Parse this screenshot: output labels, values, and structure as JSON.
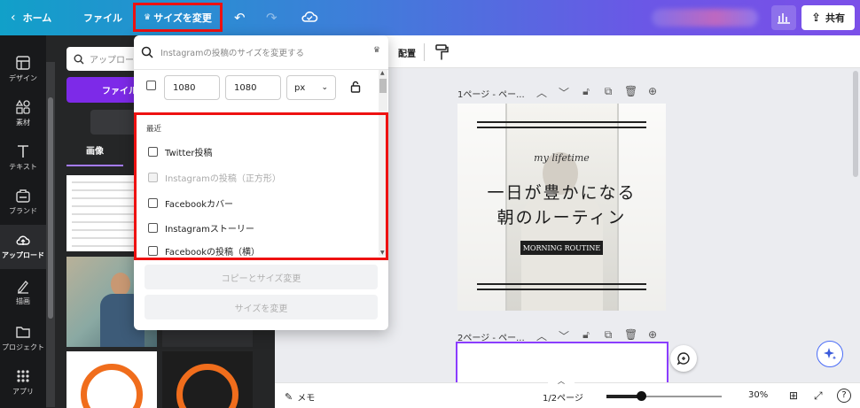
{
  "topbar": {
    "home": "ホーム",
    "file": "ファイル",
    "resize": "サイズを変更",
    "share": "共有"
  },
  "rail": [
    {
      "label": "デザイン",
      "icon": "design-icon"
    },
    {
      "label": "素材",
      "icon": "elements-icon"
    },
    {
      "label": "テキスト",
      "icon": "text-icon"
    },
    {
      "label": "ブランド",
      "icon": "brand-icon"
    },
    {
      "label": "アップロード",
      "icon": "upload-icon",
      "active": true
    },
    {
      "label": "描画",
      "icon": "draw-icon"
    },
    {
      "label": "プロジェクト",
      "icon": "folder-icon"
    },
    {
      "label": "アプリ",
      "icon": "apps-icon"
    }
  ],
  "panel": {
    "search_placeholder": "アップロー",
    "upload_button": "ファイル",
    "tab_images": "画像"
  },
  "toolbar": {
    "arrange": "配置"
  },
  "canvas": {
    "page1_label": "1ページ - ペー...",
    "page2_label": "2ページ - ペー...",
    "page1": {
      "script": "my lifetime",
      "title_line1": "一日が豊かになる",
      "title_line2": "朝のルーティン",
      "badge": "MORNING ROUTINE"
    }
  },
  "bottombar": {
    "memo": "メモ",
    "pages": "1/2ページ",
    "zoom": "30%",
    "zoom_value": 30,
    "help": "?"
  },
  "dropdown": {
    "search_placeholder": "Instagramの投稿のサイズを変更する",
    "width": "1080",
    "height": "1080",
    "unit": "px",
    "recent_title": "最近",
    "recent_items": [
      {
        "label": "Twitter投稿",
        "disabled": false
      },
      {
        "label": "Instagramの投稿（正方形）",
        "disabled": true
      },
      {
        "label": "Facebookカバー",
        "disabled": false
      },
      {
        "label": "Instagramストーリー",
        "disabled": false
      },
      {
        "label": "Facebookの投稿（横）",
        "disabled": false
      }
    ],
    "copy_resize_button": "コピーとサイズ変更",
    "resize_button": "サイズを変更"
  },
  "colors": {
    "accent": "#7d2ae8",
    "highlight": "#ee1111",
    "rail_bg": "#18191b",
    "panel_bg": "#252627"
  }
}
